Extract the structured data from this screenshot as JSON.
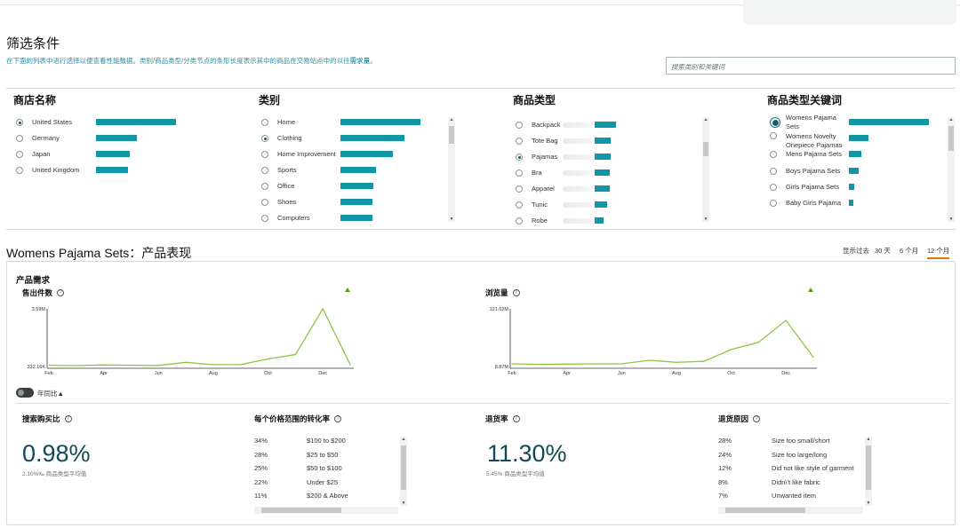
{
  "page": {
    "title": "筛选条件",
    "description": "在下面的列表中进行选择以便查看性能数据。类别/商品类型/分类节点的条形长度表示其中的商品在交易站点中的以往",
    "description_link": "需求量",
    "description_end": "。",
    "search_placeholder": "搜索类别和关键词"
  },
  "filters": {
    "stores": {
      "title": "商店名称",
      "items": [
        {
          "label": "United States",
          "bar": 1.0,
          "selected": true
        },
        {
          "label": "Germany",
          "bar": 0.51,
          "selected": false
        },
        {
          "label": "Japan",
          "bar": 0.42,
          "selected": false
        },
        {
          "label": "United Kingdom",
          "bar": 0.4,
          "selected": false
        }
      ]
    },
    "categories": {
      "title": "类别",
      "items": [
        {
          "label": "Home",
          "bar": 1.0,
          "selected": false
        },
        {
          "label": "Clothing",
          "bar": 0.8,
          "selected": true
        },
        {
          "label": "Home Improvement",
          "bar": 0.66,
          "selected": false
        },
        {
          "label": "Sports",
          "bar": 0.44,
          "selected": false
        },
        {
          "label": "Office",
          "bar": 0.41,
          "selected": false
        },
        {
          "label": "Shoes",
          "bar": 0.4,
          "selected": false
        },
        {
          "label": "Computers",
          "bar": 0.4,
          "selected": false
        }
      ]
    },
    "product_types": {
      "title": "商品类型",
      "items": [
        {
          "label": "Backpack",
          "bar": 1.0,
          "selected": false
        },
        {
          "label": "Tote Bag",
          "bar": 0.75,
          "selected": false
        },
        {
          "label": "Pajamas",
          "bar": 0.75,
          "selected": true
        },
        {
          "label": "Bra",
          "bar": 0.71,
          "selected": false
        },
        {
          "label": "Apparel",
          "bar": 0.71,
          "selected": false
        },
        {
          "label": "Tunic",
          "bar": 0.58,
          "selected": false
        },
        {
          "label": "Robe",
          "bar": 0.42,
          "selected": false
        }
      ]
    },
    "keywords": {
      "title": "商品类型关键词",
      "items": [
        {
          "label": "Womens Pajama Sets",
          "bar": 1.0,
          "selected": true
        },
        {
          "label": "Womens Novelty Onepiece Pajamas",
          "bar": 0.24,
          "selected": false
        },
        {
          "label": "Mens Pajama Sets",
          "bar": 0.16,
          "selected": false
        },
        {
          "label": "Boys Pajama Sets",
          "bar": 0.12,
          "selected": false
        },
        {
          "label": "Girls Pajama Sets",
          "bar": 0.07,
          "selected": false
        },
        {
          "label": "Baby Girls Pajama",
          "bar": 0.06,
          "selected": false
        }
      ]
    }
  },
  "performance": {
    "title": "Womens Pajama Sets：产品表现",
    "range_prefix": "显示过去",
    "range_options": [
      "30 天",
      "6 个月",
      "12 个月"
    ],
    "range_selected": "12 个月",
    "demand_title": "产品需求",
    "toggle_label": "年同比▲"
  },
  "chart_data": [
    {
      "type": "line",
      "title": "售出件数",
      "x": [
        "Feb",
        "Mar",
        "Apr",
        "May",
        "Jun",
        "Jul",
        "Aug",
        "Sep",
        "Oct",
        "Nov",
        "Dec",
        "Jan"
      ],
      "xticks": [
        "Feb",
        "Apr",
        "Jun",
        "Aug",
        "Oct",
        "Dec"
      ],
      "ytick_labels": [
        "3.59M",
        "332.16K"
      ],
      "ylim": [
        332160,
        3590000
      ],
      "values": [
        400000,
        380000,
        420000,
        400000,
        390000,
        570000,
        430000,
        440000,
        760000,
        1010000,
        3590000,
        430000
      ],
      "line_color": "#8cc63f"
    },
    {
      "type": "line",
      "title": "浏览量",
      "x": [
        "Feb",
        "Mar",
        "Apr",
        "May",
        "Jun",
        "Jul",
        "Aug",
        "Sep",
        "Oct",
        "Nov",
        "Dec",
        "Jan"
      ],
      "xticks": [
        "Feb",
        "Apr",
        "Jun",
        "Aug",
        "Oct",
        "Dec"
      ],
      "ytick_labels": [
        "121.62M",
        "8.87M"
      ],
      "ylim": [
        8870000,
        121620000
      ],
      "values": [
        14000000,
        13000000,
        13500000,
        14000000,
        14000000,
        21000000,
        17000000,
        19000000,
        42000000,
        56000000,
        99000000,
        27000000
      ],
      "line_color": "#8cc63f"
    }
  ],
  "metrics": {
    "search_to_purchase": {
      "title": "搜索购买比",
      "value": "0.98%",
      "sub": "2.10%‰ 商品类型平均值"
    },
    "conversion_by_price": {
      "title": "每个价格范围的转化率",
      "rows": [
        {
          "pct": "34%",
          "label": "$100 to $200"
        },
        {
          "pct": "28%",
          "label": "$25 to $50"
        },
        {
          "pct": "25%",
          "label": "$50 to $100"
        },
        {
          "pct": "22%",
          "label": "Under $25"
        },
        {
          "pct": "11%",
          "label": "$200 & Above"
        }
      ]
    },
    "return_rate": {
      "title": "退货率",
      "value": "11.30%",
      "sub": "5.45% 商品类型平均值"
    },
    "return_reasons": {
      "title": "退货原因",
      "rows": [
        {
          "pct": "28%",
          "label": "Size too small/short"
        },
        {
          "pct": "24%",
          "label": "Size too large/long"
        },
        {
          "pct": "12%",
          "label": "Did not like style of garment"
        },
        {
          "pct": "8%",
          "label": "Didn\\'t like fabric"
        },
        {
          "pct": "7%",
          "label": "Unwanted item"
        }
      ]
    }
  },
  "colors": {
    "bar": "#1196a8",
    "line": "#8cc63f",
    "accent_underline": "#e77600",
    "big_number": "#0f4a5a"
  }
}
